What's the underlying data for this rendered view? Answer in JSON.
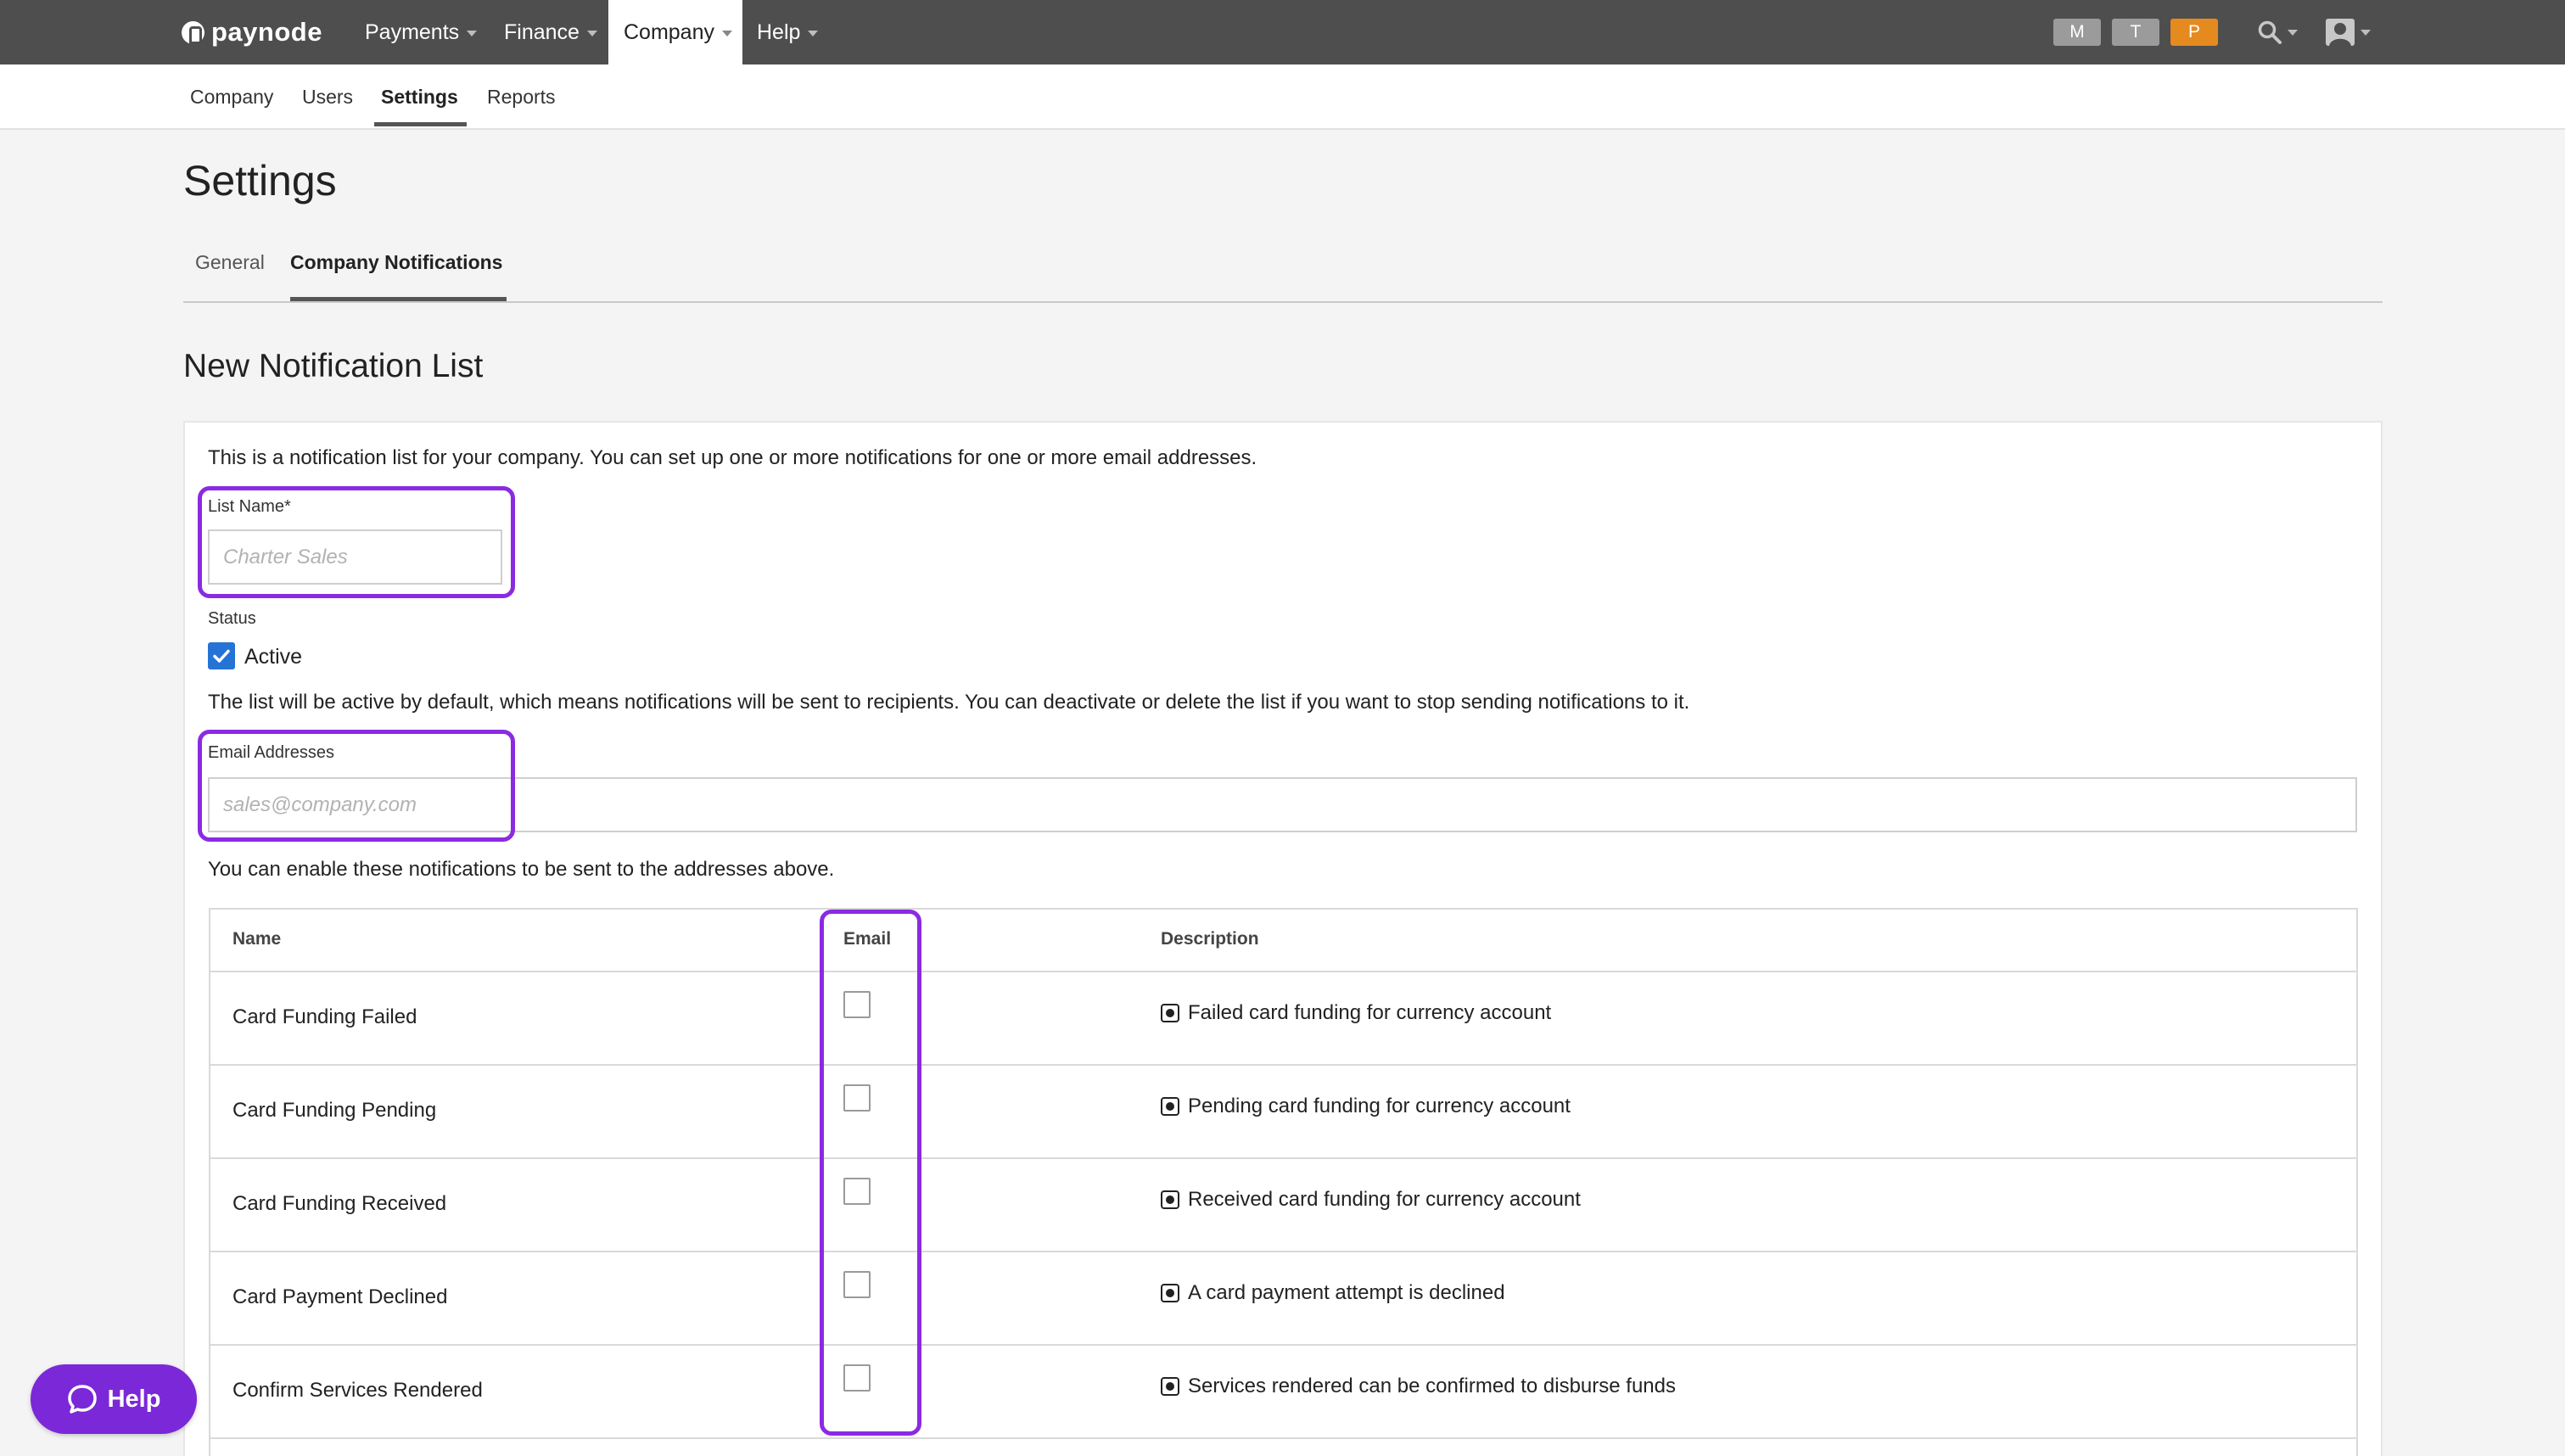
{
  "brand": {
    "name": "paynode"
  },
  "topnav": {
    "items": [
      {
        "label": "Payments",
        "active": false
      },
      {
        "label": "Finance",
        "active": false
      },
      {
        "label": "Company",
        "active": true
      },
      {
        "label": "Help",
        "active": false
      }
    ],
    "badges": [
      {
        "label": "M",
        "color": "#9b9b9b"
      },
      {
        "label": "T",
        "color": "#9b9b9b"
      },
      {
        "label": "P",
        "color": "#e58a1f"
      }
    ],
    "icons": [
      "search-icon",
      "user-avatar-icon"
    ]
  },
  "subnav": {
    "items": [
      {
        "label": "Company"
      },
      {
        "label": "Users"
      },
      {
        "label": "Settings",
        "active": true
      },
      {
        "label": "Reports"
      }
    ]
  },
  "page": {
    "title": "Settings",
    "tabs": [
      {
        "label": "General"
      },
      {
        "label": "Company Notifications",
        "active": true
      }
    ],
    "section_title": "New Notification List"
  },
  "form": {
    "intro": "This is a notification list for your company. You can set up one or more notifications for one or more email addresses.",
    "list_name": {
      "label": "List Name*",
      "placeholder": "Charter Sales",
      "value": ""
    },
    "status": {
      "label": "Status",
      "checkbox_label": "Active",
      "checked": true,
      "help": "The list will be active by default, which means notifications will be sent to recipients. You can deactivate or delete the list if you want to stop sending notifications to it."
    },
    "email": {
      "label": "Email Addresses",
      "placeholder": "sales@company.com",
      "value": ""
    },
    "notifications_intro": "You can enable these notifications to be sent to the addresses above."
  },
  "table": {
    "headers": {
      "name": "Name",
      "email": "Email",
      "description": "Description"
    },
    "rows": [
      {
        "name": "Card Funding Failed",
        "email": false,
        "description": "Failed card funding for currency account"
      },
      {
        "name": "Card Funding Pending",
        "email": false,
        "description": "Pending card funding for currency account"
      },
      {
        "name": "Card Funding Received",
        "email": false,
        "description": "Received card funding for currency account"
      },
      {
        "name": "Card Payment Declined",
        "email": false,
        "description": "A card payment attempt is declined"
      },
      {
        "name": "Confirm Services Rendered",
        "email": false,
        "description": "Services rendered can be confirmed to disburse funds"
      }
    ]
  },
  "help_widget": {
    "label": "Help"
  },
  "colors": {
    "topbar": "#4e4e4e",
    "accent": "#2673d6",
    "highlight": "#8a2be2",
    "help": "#7b28d8"
  }
}
